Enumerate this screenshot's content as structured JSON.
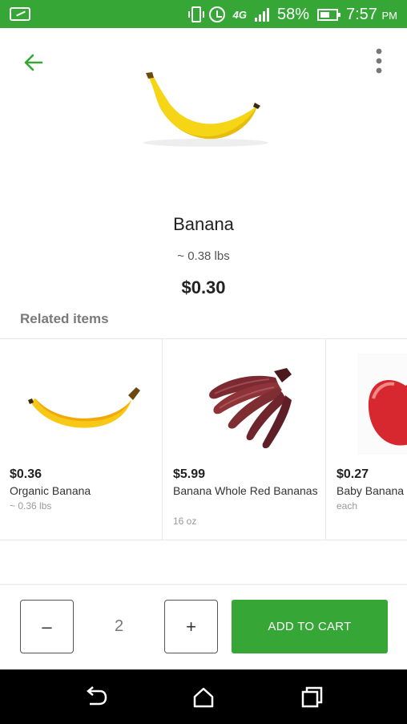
{
  "status_bar": {
    "network": "4G",
    "battery_percent": "58%",
    "time": "7:57",
    "time_suffix": "PM"
  },
  "header": {
    "back_icon": "arrow-left-icon",
    "more_icon": "more-vertical-icon"
  },
  "product": {
    "name": "Banana",
    "weight": "~ 0.38 lbs",
    "price": "$0.30",
    "image_icon": "banana-image"
  },
  "related": {
    "title": "Related items",
    "items": [
      {
        "price": "$0.36",
        "name": "Organic Banana",
        "unit": "~ 0.36 lbs",
        "image": "banana-image"
      },
      {
        "price": "$5.99",
        "name": "Banana Whole Red Bananas",
        "unit": "16 oz",
        "image": "red-banana-bunch-image"
      },
      {
        "price": "$0.27",
        "name": "Baby Banana",
        "unit": "each",
        "image": "apple-image"
      }
    ]
  },
  "cart": {
    "minus_label": "–",
    "plus_label": "+",
    "quantity": "2",
    "add_label": "ADD TO CART"
  },
  "colors": {
    "brand_green": "#36a737",
    "text_dark": "#222222",
    "text_muted": "#7a7a7a"
  }
}
